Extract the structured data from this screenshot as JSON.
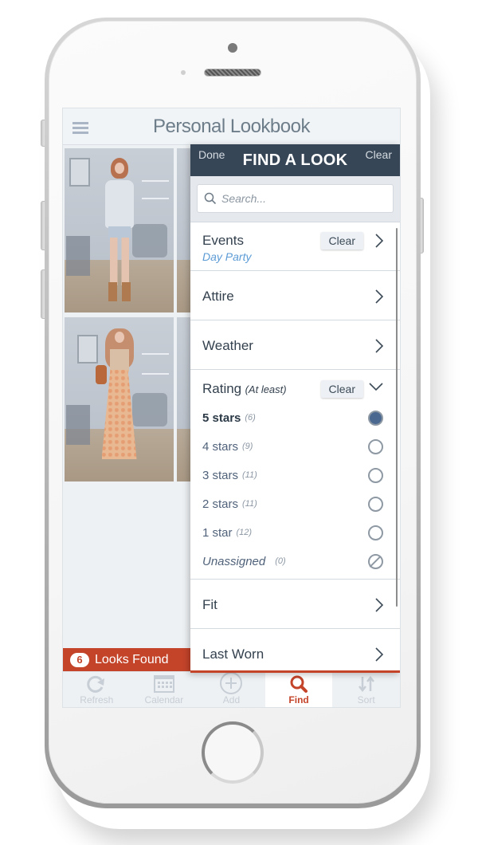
{
  "app": {
    "title": "Personal Lookbook",
    "menu_icon": "hamburger-menu-icon"
  },
  "grid": {
    "photos": [
      {
        "desc": "Woman in white fur vest, denim shorts and tan boots"
      },
      {
        "desc": "Partially visible look thumbnail"
      },
      {
        "desc": "Woman in crop top and floral maxi skirt with brown bag"
      },
      {
        "desc": "Partially visible look thumbnail"
      }
    ]
  },
  "results": {
    "count": "6",
    "label": "Looks Found"
  },
  "tabbar": {
    "tabs": [
      {
        "label": "Refresh",
        "icon": "refresh-icon",
        "active": false
      },
      {
        "label": "Calendar",
        "icon": "calendar-icon",
        "active": false
      },
      {
        "label": "Add",
        "icon": "add-circle-icon",
        "active": false
      },
      {
        "label": "Find",
        "icon": "search-icon",
        "active": true
      },
      {
        "label": "Sort",
        "icon": "sort-arrows-icon",
        "active": false
      }
    ]
  },
  "panel": {
    "title": "FIND A LOOK",
    "done_label": "Done",
    "clear_label": "Clear",
    "search": {
      "placeholder": "Search...",
      "value": ""
    },
    "sections": {
      "events": {
        "label": "Events",
        "value": "Day Party",
        "clear_label": "Clear"
      },
      "attire": {
        "label": "Attire"
      },
      "weather": {
        "label": "Weather"
      },
      "rating": {
        "label": "Rating",
        "note": "(At least)",
        "clear_label": "Clear",
        "expanded": true,
        "options": [
          {
            "label": "5 stars",
            "count": "(6)",
            "selected": true
          },
          {
            "label": "4 stars",
            "count": "(9)",
            "selected": false
          },
          {
            "label": "3 stars",
            "count": "(11)",
            "selected": false
          },
          {
            "label": "2 stars",
            "count": "(11)",
            "selected": false
          },
          {
            "label": "1 star",
            "count": "(12)",
            "selected": false
          },
          {
            "label": "Unassigned",
            "count": "(0)",
            "selected": false
          }
        ]
      },
      "fit": {
        "label": "Fit"
      },
      "last_worn": {
        "label": "Last Worn"
      }
    }
  },
  "colors": {
    "accent": "#c4442a",
    "panel_header": "#364656",
    "link": "#5b9bd5",
    "radio_selected": "#4a6890"
  }
}
